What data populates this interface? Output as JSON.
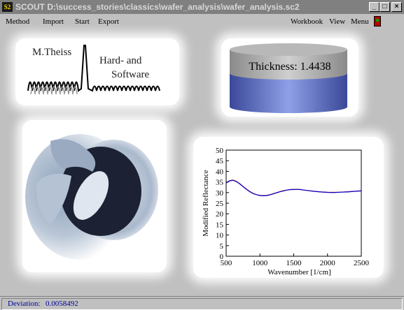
{
  "window": {
    "app_icon": "S2",
    "title": "SCOUT D:\\success_stories\\classics\\wafer_analysis\\wafer_analysis.sc2",
    "controls": {
      "minimize": "_",
      "maximize": "□",
      "close": "×"
    }
  },
  "menu": {
    "left": [
      "Method",
      "Import",
      "Start",
      "Export"
    ],
    "right": [
      "Workbook",
      "View",
      "Menu"
    ]
  },
  "logo": {
    "name": "M.Theiss",
    "line1": "Hard- and",
    "line2": "Software"
  },
  "thickness": {
    "label": "Thickness: 1.4438",
    "top_color": "#9a9a9a",
    "body_color": "#4a5aaa"
  },
  "photo": {
    "icon": "wafer-photo"
  },
  "chart_data": {
    "type": "line",
    "xlabel": "Wavenumber [1/cm]",
    "ylabel": "Modified Reflectance",
    "xlim": [
      500,
      2500
    ],
    "ylim": [
      0,
      50
    ],
    "xticks": [
      500,
      1000,
      1500,
      2000,
      2500
    ],
    "yticks": [
      0,
      5,
      10,
      15,
      20,
      25,
      30,
      35,
      40,
      45,
      50
    ],
    "series": [
      {
        "color": "#dd0000",
        "x": [
          500,
          550,
          600,
          650,
          700,
          750,
          800,
          850,
          900,
          950,
          1000,
          1050,
          1100,
          1150,
          1200,
          1250,
          1300,
          1350,
          1400,
          1450,
          1500,
          1550,
          1600,
          1650,
          1700,
          1800,
          1900,
          2000,
          2100,
          2200,
          2300,
          2400,
          2500
        ],
        "y": [
          34.5,
          35.6,
          35.9,
          35.3,
          34.2,
          32.9,
          31.6,
          30.5,
          29.6,
          29.0,
          28.7,
          28.6,
          28.7,
          29.0,
          29.5,
          30.0,
          30.5,
          30.9,
          31.2,
          31.4,
          31.5,
          31.5,
          31.4,
          31.2,
          31.0,
          30.6,
          30.3,
          30.1,
          30.1,
          30.2,
          30.4,
          30.6,
          30.8
        ]
      },
      {
        "color": "#0000cc",
        "x": [
          500,
          550,
          600,
          650,
          700,
          750,
          800,
          850,
          900,
          950,
          1000,
          1050,
          1100,
          1150,
          1200,
          1250,
          1300,
          1350,
          1400,
          1450,
          1500,
          1550,
          1600,
          1650,
          1700,
          1800,
          1900,
          2000,
          2100,
          2200,
          2300,
          2400,
          2500
        ],
        "y": [
          34.6,
          35.5,
          35.8,
          35.2,
          34.1,
          32.8,
          31.5,
          30.4,
          29.5,
          29.0,
          28.6,
          28.5,
          28.6,
          28.9,
          29.4,
          29.9,
          30.4,
          30.8,
          31.2,
          31.4,
          31.4,
          31.5,
          31.4,
          31.2,
          31.0,
          30.6,
          30.3,
          30.1,
          30.0,
          30.2,
          30.3,
          30.6,
          30.8
        ]
      }
    ]
  },
  "status": {
    "label": "Deviation:",
    "value": "0.0058492"
  }
}
